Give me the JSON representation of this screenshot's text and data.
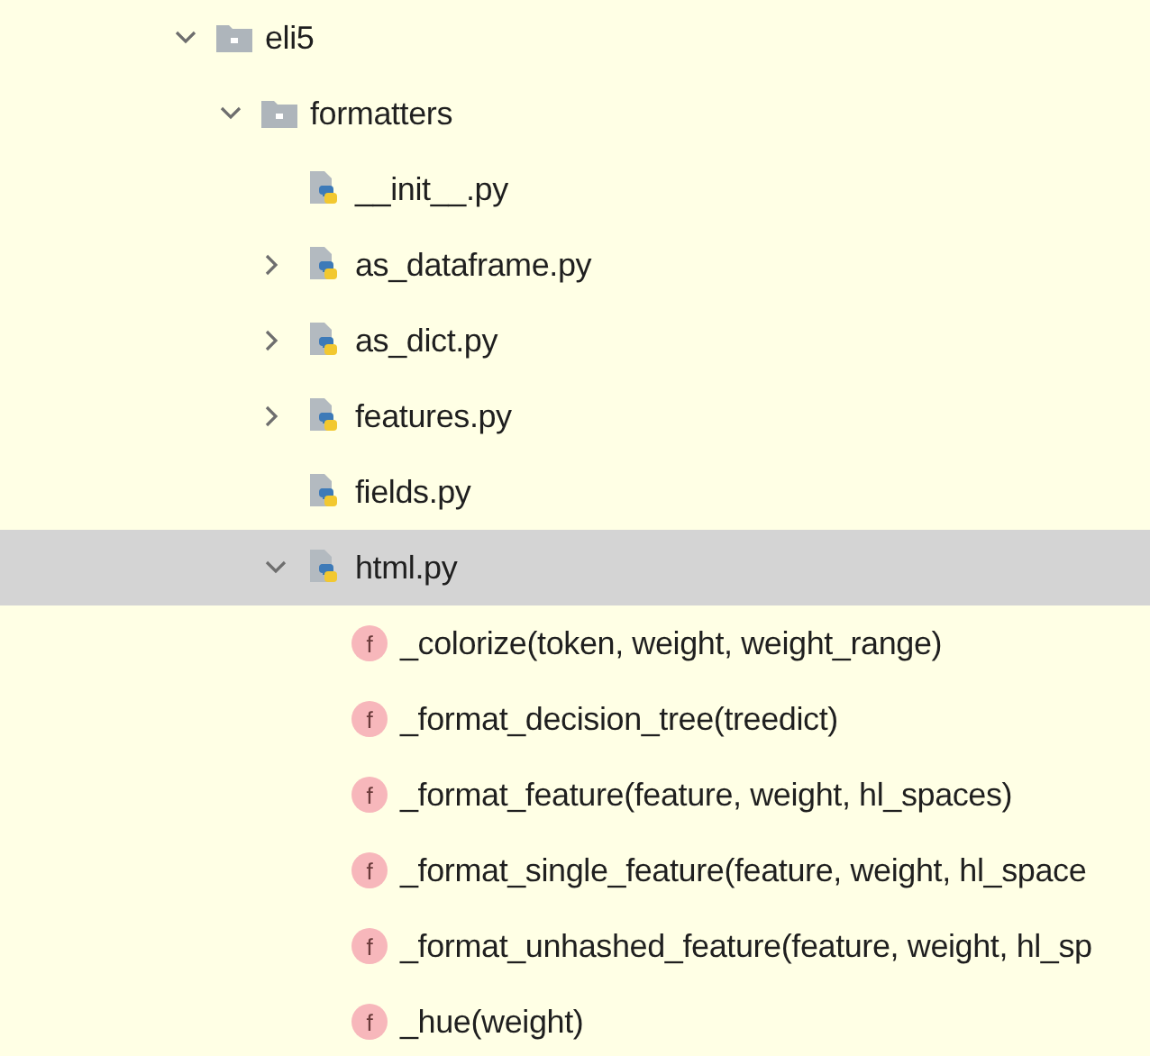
{
  "tree": [
    {
      "kind": "folder",
      "label": "eli5",
      "expanded": true,
      "selected": false,
      "children": [
        {
          "kind": "folder",
          "label": "formatters",
          "expanded": true,
          "selected": false,
          "children": [
            {
              "kind": "python",
              "label": "__init__.py",
              "selected": false
            },
            {
              "kind": "python",
              "label": "as_dataframe.py",
              "expanded": false,
              "selected": false
            },
            {
              "kind": "python",
              "label": "as_dict.py",
              "expanded": false,
              "selected": false
            },
            {
              "kind": "python",
              "label": "features.py",
              "expanded": false,
              "selected": false
            },
            {
              "kind": "python",
              "label": "fields.py",
              "selected": false
            },
            {
              "kind": "python",
              "label": "html.py",
              "expanded": true,
              "selected": true,
              "children": [
                {
                  "kind": "function",
                  "icon_letter": "f",
                  "label": "_colorize(token, weight, weight_range)",
                  "selected": false
                },
                {
                  "kind": "function",
                  "icon_letter": "f",
                  "label": "_format_decision_tree(treedict)",
                  "selected": false
                },
                {
                  "kind": "function",
                  "icon_letter": "f",
                  "label": "_format_feature(feature, weight, hl_spaces)",
                  "selected": false
                },
                {
                  "kind": "function",
                  "icon_letter": "f",
                  "label": "_format_single_feature(feature, weight, hl_space",
                  "selected": false
                },
                {
                  "kind": "function",
                  "icon_letter": "f",
                  "label": "_format_unhashed_feature(feature, weight, hl_sp",
                  "selected": false
                },
                {
                  "kind": "function",
                  "icon_letter": "f",
                  "label": "_hue(weight)",
                  "selected": false
                }
              ]
            }
          ]
        }
      ]
    }
  ]
}
